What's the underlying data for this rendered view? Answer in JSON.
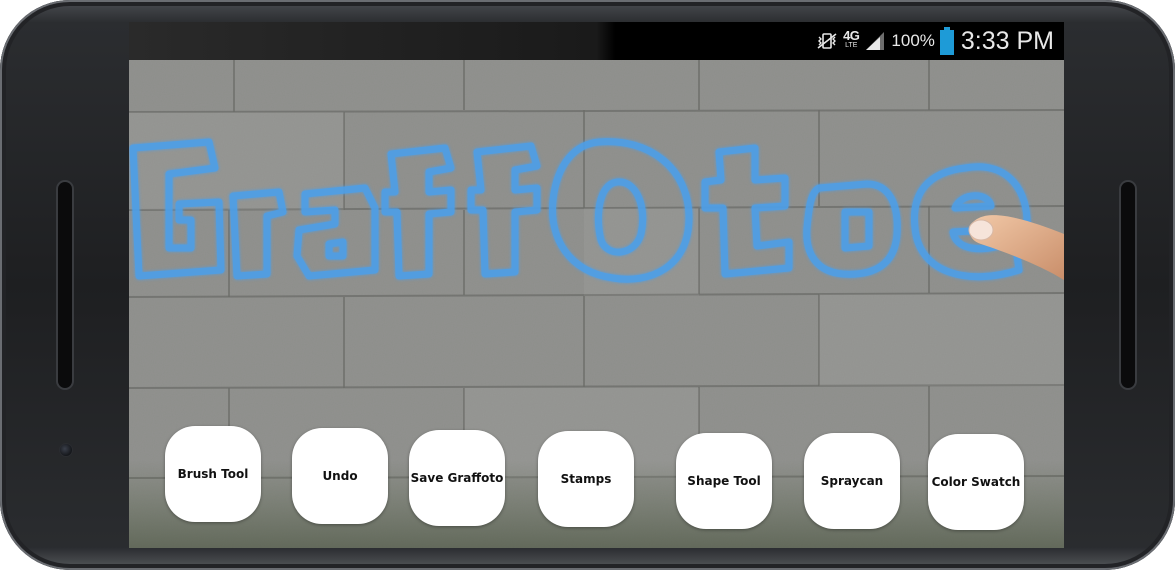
{
  "app": {
    "title": "Graffoto",
    "graffiti_color": "#4d9fe8"
  },
  "status_bar": {
    "network_type": "4G",
    "network_sub": "LTE",
    "battery_percent": "100%",
    "battery_color": "#1e9bd7",
    "time": "3:33 PM",
    "icons": [
      "vibrate-icon",
      "lte-data-icon",
      "signal-strength-icon",
      "battery-icon"
    ]
  },
  "toolbar": {
    "buttons": [
      {
        "label": "Brush Tool"
      },
      {
        "label": "Undo"
      },
      {
        "label": "Save Graffoto"
      },
      {
        "label": "Stamps"
      },
      {
        "label": "Shape Tool"
      },
      {
        "label": "Spraycan"
      },
      {
        "label": "Color Swatch"
      }
    ]
  },
  "colors": {
    "button_bg": "#ffffff",
    "button_text": "#111111",
    "wall": "#8b8c88"
  }
}
